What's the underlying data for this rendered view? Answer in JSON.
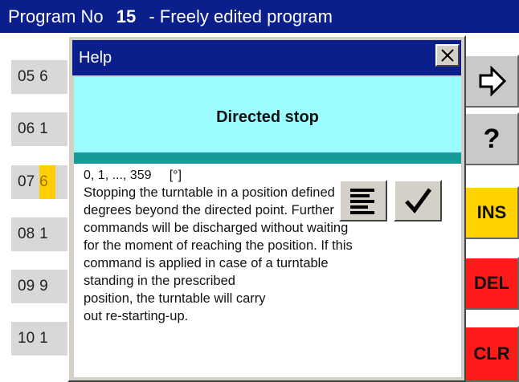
{
  "header": {
    "prefix": "Program No",
    "number": "15",
    "separator": "-",
    "title": "Freely edited program"
  },
  "rows": [
    {
      "num": "05",
      "val": "6"
    },
    {
      "num": "06",
      "val": "1"
    },
    {
      "num": "07",
      "val": "6"
    },
    {
      "num": "08",
      "val": "1"
    },
    {
      "num": "09",
      "val": "9"
    },
    {
      "num": "10",
      "val": "1"
    }
  ],
  "right_buttons": {
    "question": "?",
    "ins": "INS",
    "del": "DEL",
    "clr": "CLR"
  },
  "dialog": {
    "title": "Help",
    "heading": "Directed stop",
    "range": "0, 1, ..., 359     [°]",
    "lines": [
      "Stopping the turntable in a position defined in",
      "degrees beyond the directed point. Further",
      "commands will be discharged without waiting",
      "for the moment of reaching the position. If this",
      "command is applied in case of a turntable",
      "standing in the prescribed",
      "position, the turntable will carry",
      "out  re-starting-up."
    ]
  },
  "colors": {
    "titlebar": "#0a1e8c",
    "help_heading_bg": "#9cfcff",
    "strip": "#169a9a",
    "ins": "#ffd200",
    "del": "#ff1a1a"
  },
  "icons": [
    "close-icon",
    "enter-arrow-icon",
    "list-icon",
    "checkmark-icon"
  ]
}
